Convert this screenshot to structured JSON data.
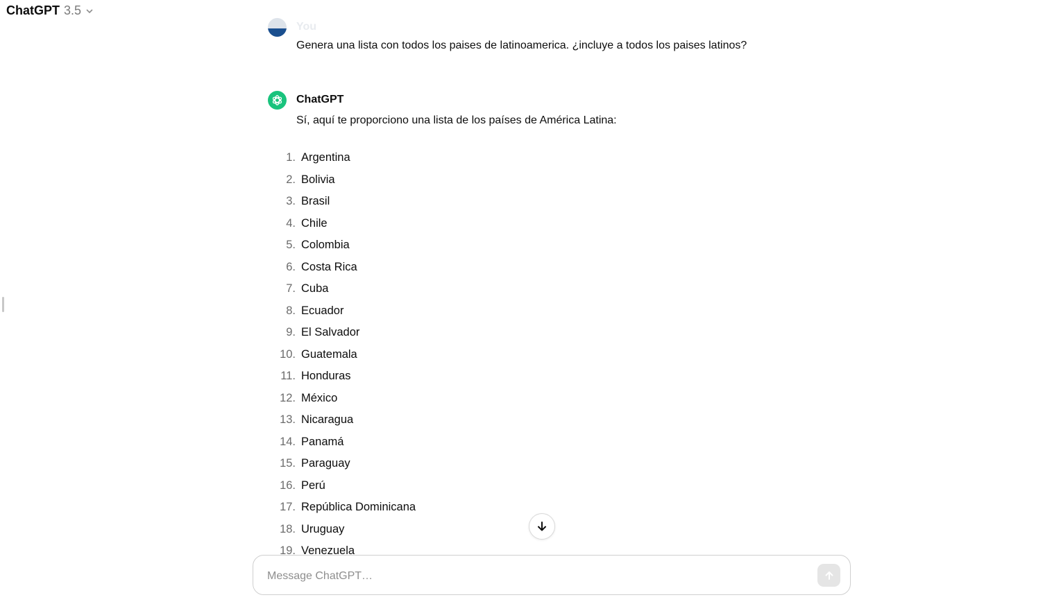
{
  "header": {
    "model_name": "ChatGPT",
    "model_version": "3.5",
    "chevron_icon": "chevron-down-icon"
  },
  "conversation": {
    "user_message": {
      "author": "You",
      "text": "Genera una lista con todos los paises de latinoamerica. ¿incluye a todos los paises latinos?"
    },
    "assistant_message": {
      "author": "ChatGPT",
      "intro": "Sí, aquí te proporciono una lista de los países de América Latina:",
      "list": [
        {
          "num": "1.",
          "name": "Argentina"
        },
        {
          "num": "2.",
          "name": "Bolivia"
        },
        {
          "num": "3.",
          "name": "Brasil"
        },
        {
          "num": "4.",
          "name": "Chile"
        },
        {
          "num": "5.",
          "name": "Colombia"
        },
        {
          "num": "6.",
          "name": "Costa Rica"
        },
        {
          "num": "7.",
          "name": "Cuba"
        },
        {
          "num": "8.",
          "name": "Ecuador"
        },
        {
          "num": "9.",
          "name": "El Salvador"
        },
        {
          "num": "10.",
          "name": "Guatemala"
        },
        {
          "num": "11.",
          "name": "Honduras"
        },
        {
          "num": "12.",
          "name": "México"
        },
        {
          "num": "13.",
          "name": "Nicaragua"
        },
        {
          "num": "14.",
          "name": "Panamá"
        },
        {
          "num": "15.",
          "name": "Paraguay"
        },
        {
          "num": "16.",
          "name": "Perú"
        },
        {
          "num": "17.",
          "name": "República Dominicana"
        },
        {
          "num": "18.",
          "name": "Uruguay"
        },
        {
          "num": "19.",
          "name": "Venezuela"
        }
      ]
    }
  },
  "composer": {
    "placeholder": "Message ChatGPT…",
    "value": "",
    "send_icon": "arrow-up-icon"
  },
  "scroll_button_icon": "arrow-down-icon",
  "colors": {
    "accent_gpt": "#19c37d",
    "user_avatar": "#1a4f8f"
  }
}
